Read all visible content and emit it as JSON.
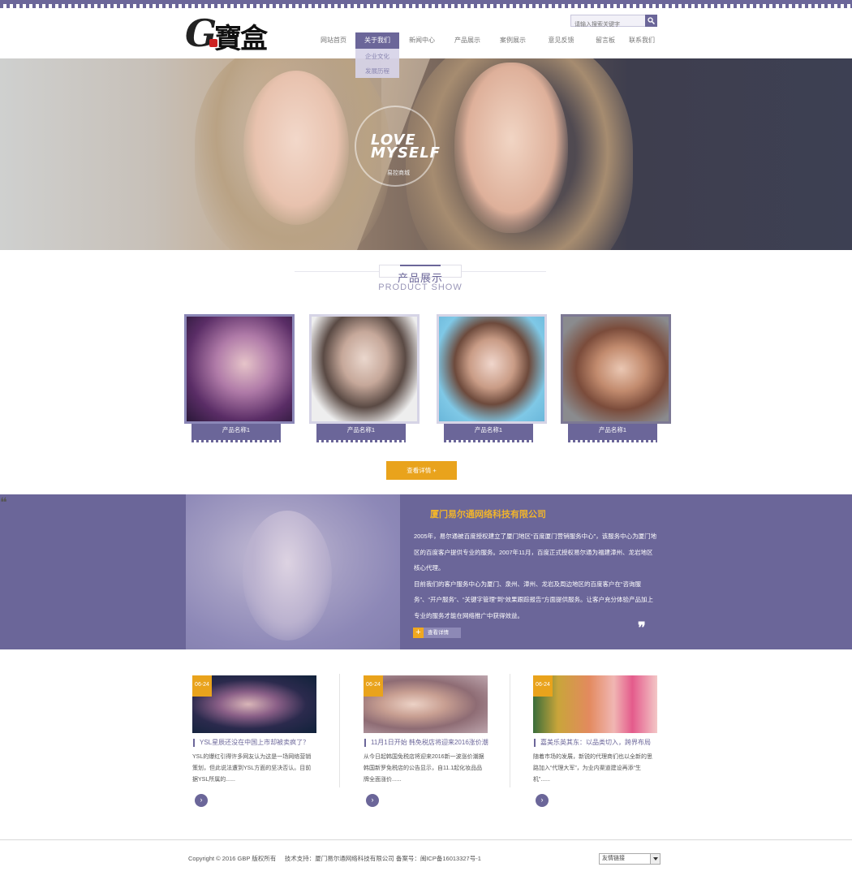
{
  "header": {
    "logo_text": "G寶盒",
    "search_placeholder": "请输入搜索关键字",
    "nav": [
      {
        "label": "网站首页"
      },
      {
        "label": "关于我们"
      },
      {
        "label": "新闻中心"
      },
      {
        "label": "产品展示"
      },
      {
        "label": "案例展示"
      },
      {
        "label": "意见反馈"
      },
      {
        "label": "留言板"
      },
      {
        "label": "联系我们"
      }
    ],
    "submenu": [
      {
        "label": "企业文化"
      },
      {
        "label": "发展历程"
      }
    ]
  },
  "banner": {
    "line1": "LOVE",
    "line2": "MYSELF",
    "sub": "易控商城"
  },
  "products": {
    "title_cn": "产品展示",
    "title_en": "PRODUCT SHOW",
    "items": [
      {
        "name": "产品名称1"
      },
      {
        "name": "产品名称1"
      },
      {
        "name": "产品名称1"
      },
      {
        "name": "产品名称1"
      }
    ],
    "more_label": "查看详情 +"
  },
  "about": {
    "title": "厦门易尔通网络科技有限公司",
    "p1": "2005年，易尔通被百度授权建立了厦门地区“百度厦门营销服务中心”，该服务中心为厦门地区的百度客户提供专业的服务。2007年11月，百度正式授权易尔通为福建漳州、龙岩地区核心代理。",
    "p2": "目前我们的客户服务中心为厦门、泉州、漳州、龙岩及周边地区的百度客户在“咨询服务”、“开户服务”、“关键字管理”到“效果跟踪报告”方面提供服务。让客户充分体验产品加上专业的服务才能在网络推广中获得效益。",
    "btn": "查看详情"
  },
  "news": [
    {
      "date": "06-24",
      "title": "YSL星辰还没在中国上市却被卖疯了？",
      "desc": "YSL的爆红引得许多网友认为这是一场网络营销策划，但此说法遭到YSL方面的坚决否认。目前据YSL所属的......"
    },
    {
      "date": "06-24",
      "title": "11月1日开始 韩免税店将迎来2016涨价潮",
      "desc": "从今日起韩国免税店将迎来2016新一波涨价潮据韩国新罗免税店的公告显示，自11.1起化妆品品牌全面涨价......"
    },
    {
      "date": "06-24",
      "title": "嘉美乐英其东：以品类切入，跨界布局",
      "desc": "随着市场的发展，新锐的代理商们也以全新的思路加入“代理大军”，为业内渠道建设再添“生机”......"
    }
  ],
  "footer": {
    "copyright": "Copyright © 2016 GBP 版权所有     技术支持：厦门易尔通网络科技有限公司 备案号：闽ICP备16013327号-1",
    "links_select": "友情链接"
  }
}
